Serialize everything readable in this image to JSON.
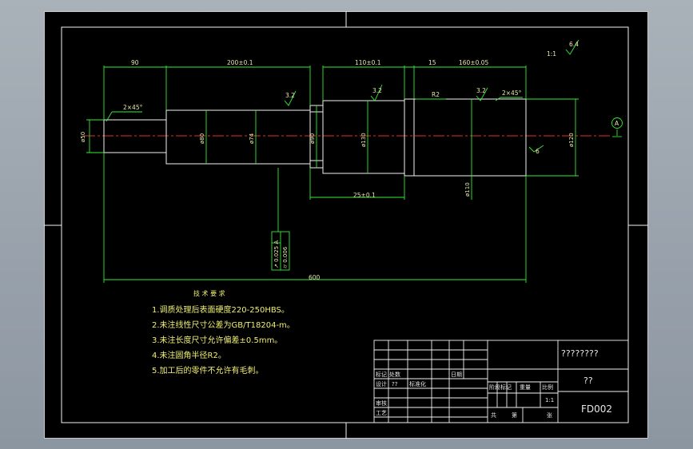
{
  "drawing": {
    "scale_note": "1:1",
    "roughness_general": "6.4",
    "datum_label": "A",
    "dimensions": {
      "len_90": "90",
      "len_200": "200±0.1",
      "len_110": "110±0.1",
      "len_15": "15",
      "len_160": "160±0.05",
      "len_25": "25±0.1",
      "len_600": "600",
      "chamfer_left": "2×45°",
      "chamfer_right": "2×45°",
      "radius": "R2",
      "rough_1": "3.2",
      "rough_2": "3.2",
      "rough_3": "3.2",
      "rough_4": "6",
      "dia_50": "ø50",
      "dia_80": "ø80",
      "dia_74": "ø74",
      "dia_90": "ø90",
      "dia_130": "ø130",
      "dia_110": "ø110",
      "dia_120": "ø120"
    },
    "tolerance_frame": [
      "↗ 0.025 A",
      "⌭ 0.006"
    ]
  },
  "notes": {
    "title": "技 术 要 求",
    "items": [
      "1.调质处理后表面硬度220-250HBS。",
      "2.未注线性尺寸公差为GB/T18204-m。",
      "3.未注长度尺寸允许偏差±0.5mm。",
      "4.未注圆角半径R2。",
      "5.加工后的零件不允许有毛刺。"
    ]
  },
  "title_block": {
    "part_name": "????????",
    "material": "??",
    "drawing_number": "FD002",
    "scale": "1:1",
    "labels": {
      "mark": "标记",
      "count": "处数",
      "designer": "设计",
      "designer_name": "??",
      "standardize": "标准化",
      "review": "审核",
      "process": "工艺",
      "date": "日期",
      "stage_mark": "阶段标记",
      "weight": "重量",
      "ratio": "比例",
      "sheets": "共",
      "sheet_no": "第",
      "sheet": "张"
    }
  }
}
